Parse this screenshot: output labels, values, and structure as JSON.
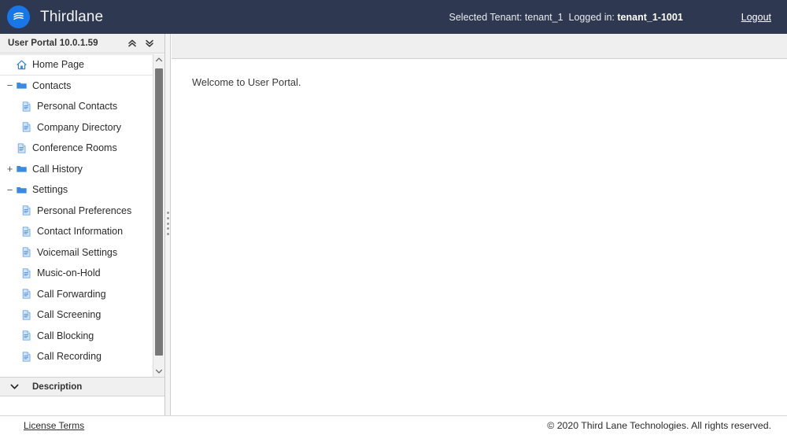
{
  "header": {
    "brand": "Thirdlane",
    "logo_icon": "thirdlane-waves-icon",
    "logo_color": "#1877e8",
    "background_color": "#2e3850",
    "tenant_label": "Selected Tenant:",
    "tenant_value": "tenant_1",
    "logged_in_label": "Logged in:",
    "logged_in_value": "tenant_1-1001",
    "logout_label": "Logout"
  },
  "sidebar": {
    "title": "User Portal 10.0.1.59",
    "collapse_all_icon": "double-chevron-up-icon",
    "expand_all_icon": "double-chevron-down-icon",
    "scroll_up_icon": "chevron-up-icon",
    "scroll_down_icon": "chevron-down-icon",
    "tree": [
      {
        "label": "Home Page",
        "icon": "home-icon",
        "level": 0,
        "kind": "leaf",
        "toggle": "",
        "selected": true
      },
      {
        "label": "Contacts",
        "icon": "folder-icon",
        "level": 0,
        "kind": "folder",
        "toggle": "−",
        "selected": false
      },
      {
        "label": "Personal Contacts",
        "icon": "document-icon",
        "level": 1,
        "kind": "leaf",
        "toggle": "",
        "selected": false
      },
      {
        "label": "Company Directory",
        "icon": "document-icon",
        "level": 1,
        "kind": "leaf",
        "toggle": "",
        "selected": false
      },
      {
        "label": "Conference Rooms",
        "icon": "document-icon",
        "level": 0,
        "kind": "leaf",
        "toggle": "",
        "selected": false
      },
      {
        "label": "Call History",
        "icon": "folder-icon",
        "level": 0,
        "kind": "folder",
        "toggle": "+",
        "selected": false
      },
      {
        "label": "Settings",
        "icon": "folder-icon",
        "level": 0,
        "kind": "folder",
        "toggle": "−",
        "selected": false
      },
      {
        "label": "Personal Preferences",
        "icon": "document-icon",
        "level": 1,
        "kind": "leaf",
        "toggle": "",
        "selected": false
      },
      {
        "label": "Contact Information",
        "icon": "document-icon",
        "level": 1,
        "kind": "leaf",
        "toggle": "",
        "selected": false
      },
      {
        "label": "Voicemail Settings",
        "icon": "document-icon",
        "level": 1,
        "kind": "leaf",
        "toggle": "",
        "selected": false
      },
      {
        "label": "Music-on-Hold",
        "icon": "document-icon",
        "level": 1,
        "kind": "leaf",
        "toggle": "",
        "selected": false
      },
      {
        "label": "Call Forwarding",
        "icon": "document-icon",
        "level": 1,
        "kind": "leaf",
        "toggle": "",
        "selected": false
      },
      {
        "label": "Call Screening",
        "icon": "document-icon",
        "level": 1,
        "kind": "leaf",
        "toggle": "",
        "selected": false
      },
      {
        "label": "Call Blocking",
        "icon": "document-icon",
        "level": 1,
        "kind": "leaf",
        "toggle": "",
        "selected": false
      },
      {
        "label": "Call Recording",
        "icon": "document-icon",
        "level": 1,
        "kind": "leaf",
        "toggle": "",
        "selected": false
      }
    ],
    "description_panel": {
      "title": "Description",
      "chevron_icon": "chevron-down-icon",
      "body_text": ""
    }
  },
  "main": {
    "welcome_text": "Welcome to User Portal."
  },
  "footer": {
    "license_label": "License Terms",
    "copyright": "© 2020 Third Lane Technologies. All rights reserved."
  }
}
